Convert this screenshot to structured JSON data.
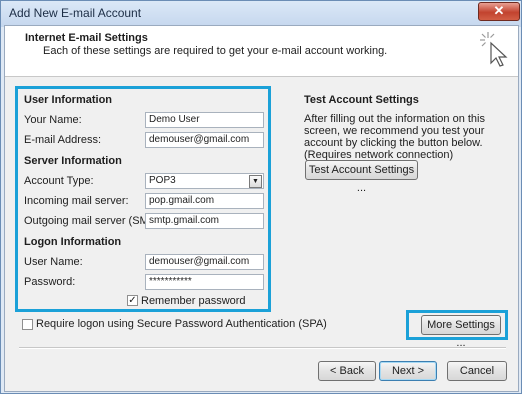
{
  "window": {
    "title": "Add New E-mail Account",
    "close_label": "✕"
  },
  "header": {
    "title": "Internet E-mail Settings",
    "subtitle": "Each of these settings are required to get your e-mail account working."
  },
  "user_info": {
    "heading": "User Information",
    "your_name": {
      "label": "Your Name:",
      "value": "Demo User"
    },
    "email": {
      "label": "E-mail Address:",
      "value": "demouser@gmail.com"
    }
  },
  "server_info": {
    "heading": "Server Information",
    "account_type": {
      "label": "Account Type:",
      "value": "POP3"
    },
    "incoming": {
      "label": "Incoming mail server:",
      "value": "pop.gmail.com"
    },
    "outgoing": {
      "label": "Outgoing mail server (SMTP):",
      "value": "smtp.gmail.com"
    }
  },
  "logon_info": {
    "heading": "Logon Information",
    "user_name": {
      "label": "User Name:",
      "value": "demouser@gmail.com"
    },
    "password": {
      "label": "Password:",
      "value": "***********"
    },
    "remember": {
      "label": "Remember password",
      "checked": true
    }
  },
  "spa": {
    "label": "Require logon using Secure Password Authentication (SPA)",
    "checked": false
  },
  "test": {
    "heading": "Test Account Settings",
    "description": "After filling out the information on this screen, we recommend you test your account by clicking the button below. (Requires network connection)",
    "button": "Test Account Settings ..."
  },
  "more_settings": "More Settings ...",
  "footer": {
    "back": "< Back",
    "next": "Next >",
    "cancel": "Cancel"
  },
  "colors": {
    "highlight": "#1ba1d8",
    "title_bar": "#c5d7ee",
    "close": "#c2432f"
  },
  "icons": {
    "header": "cursor-sparkle-icon",
    "dropdown": "chevron-down-icon",
    "check": "checkmark-icon"
  }
}
